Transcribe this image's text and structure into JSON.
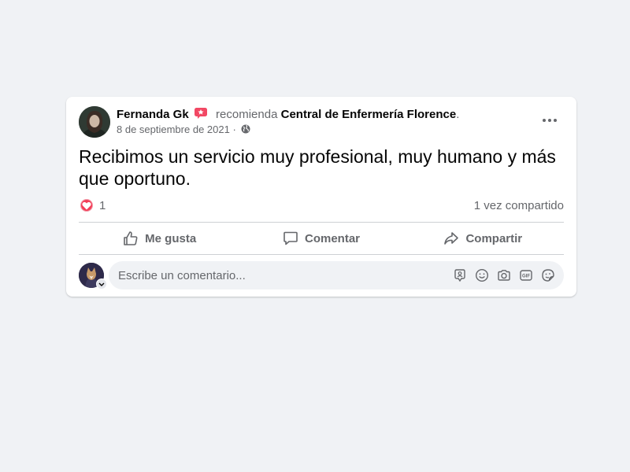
{
  "post": {
    "author": "Fernanda Gk",
    "recommends_text": "recomienda",
    "page_name": "Central de Enfermería Florence",
    "period": ".",
    "date": "8 de septiembre de 2021",
    "separator": "·",
    "privacy_icon": "globe-icon",
    "text": "Recibimos un servicio muy profesional, muy humano y más que oportuno.",
    "reaction_count": "1",
    "reaction_icon": "heart-icon",
    "shares": "1 vez compartido"
  },
  "actions": {
    "like": "Me gusta",
    "comment": "Comentar",
    "share": "Compartir"
  },
  "comment_box": {
    "placeholder": "Escribe un comentario...",
    "value": ""
  },
  "tools": [
    "avatar-sticker-icon",
    "emoji-icon",
    "camera-icon",
    "gif-icon",
    "sticker-icon"
  ],
  "colors": {
    "background": "#f0f2f5",
    "card": "#ffffff",
    "text_primary": "#050505",
    "text_secondary": "#65676b",
    "heart": "#f33e58",
    "badge": "#f02849"
  }
}
